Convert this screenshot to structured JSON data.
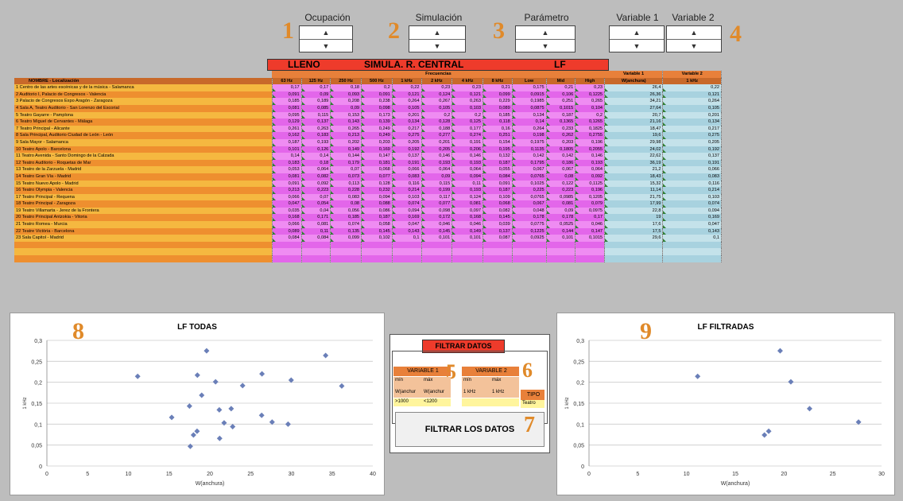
{
  "controls": [
    {
      "label": "Ocupación",
      "number": "1"
    },
    {
      "label": "Simulación",
      "number": "2"
    },
    {
      "label": "Parámetro",
      "number": "3"
    },
    {
      "label": "Variable 1",
      "number": ""
    },
    {
      "label": "Variable 2",
      "number": "4"
    }
  ],
  "spinner": {
    "up": "▲",
    "down": "▼"
  },
  "header": {
    "lleno": "LLENO",
    "simula": "SIMULA. R. CENTRAL",
    "lf": "LF",
    "frecuencias": "Frecuencias",
    "var1": "Variable 1",
    "var2": "Variable 2",
    "name_col": "NOMBRE - Localización",
    "freq_cols": [
      "63 Hz",
      "125 Hz",
      "250 Hz",
      "500 Hz",
      "1 kHz",
      "2 kHz",
      "4 kHz",
      "8 kHz",
      "Low",
      "Mid",
      "High"
    ],
    "var1_col": "W(anchura)",
    "var2_col": "1 kHz"
  },
  "rows": [
    {
      "name": "1  Centro de las artes escénicas y de la música - Salamanca",
      "f": [
        "0,17",
        "0,17",
        "0,18",
        "0,2",
        "0,22",
        "0,23",
        "0,23",
        "0,21",
        "0,175",
        "0,21",
        "0,23"
      ],
      "v1": "26,4",
      "v2": "0,22"
    },
    {
      "name": "2  Auditorio I, Palacio de Congresos - Valencia",
      "f": [
        "0,091",
        "0,09",
        "0,093",
        "0,091",
        "0,121",
        "0,124",
        "0,121",
        "0,099",
        "0,0915",
        "0,106",
        "0,1225"
      ],
      "v1": "26,36",
      "v2": "0,121"
    },
    {
      "name": "3  Palacio de Congresos Expo Aragón - Zaragoza",
      "f": [
        "0,185",
        "0,189",
        "0,208",
        "0,238",
        "0,264",
        "0,267",
        "0,263",
        "0,229",
        "0,1985",
        "0,251",
        "0,265"
      ],
      "v1": "34,21",
      "v2": "0,264"
    },
    {
      "name": "4  Sala A, Teatro Auditorio - San Lorenzo del Escorial",
      "f": [
        "0,081",
        "0,085",
        "0,09",
        "0,098",
        "0,105",
        "0,105",
        "0,103",
        "0,089",
        "0,0875",
        "0,1015",
        "0,104"
      ],
      "v1": "27,64",
      "v2": "0,105"
    },
    {
      "name": "5  Teatro Gayarre - Pamplona",
      "f": [
        "0,095",
        "0,115",
        "0,153",
        "0,173",
        "0,201",
        "0,2",
        "0,2",
        "0,185",
        "0,134",
        "0,187",
        "0,2"
      ],
      "v1": "20,7",
      "v2": "0,201"
    },
    {
      "name": "6  Teatro Miguel de Cervantes - Málaga",
      "f": [
        "0,129",
        "0,137",
        "0,143",
        "0,139",
        "0,134",
        "0,128",
        "0,125",
        "0,118",
        "0,14",
        "0,1365",
        "0,1265"
      ],
      "v1": "21,16",
      "v2": "0,134"
    },
    {
      "name": "7  Teatro Principal - Alicante",
      "f": [
        "0,261",
        "0,263",
        "0,265",
        "0,249",
        "0,217",
        "0,188",
        "0,177",
        "0,16",
        "0,264",
        "0,233",
        "0,1825"
      ],
      "v1": "18,47",
      "v2": "0,217"
    },
    {
      "name": "8  Sala Principal, Auditorio Ciudad de León - León",
      "f": [
        "0,162",
        "0,183",
        "0,213",
        "0,249",
        "0,275",
        "0,277",
        "0,274",
        "0,251",
        "0,198",
        "0,262",
        "0,2755"
      ],
      "v1": "19,6",
      "v2": "0,275"
    },
    {
      "name": "9  Sala Mayor - Salamanca",
      "f": [
        "0,187",
        "0,193",
        "0,202",
        "0,203",
        "0,205",
        "0,201",
        "0,191",
        "0,154",
        "0,1975",
        "0,203",
        "0,196"
      ],
      "v1": "29,98",
      "v2": "0,205"
    },
    {
      "name": "10  Teatro Apolo - Barcelona",
      "f": [
        "0,101",
        "0,126",
        "0,149",
        "0,169",
        "0,192",
        "0,205",
        "0,206",
        "0,195",
        "0,1135",
        "0,1805",
        "0,2055"
      ],
      "v1": "24,02",
      "v2": "0,192"
    },
    {
      "name": "11  Teatro Avenida - Santo Domingo de la Calzada",
      "f": [
        "0,14",
        "0,14",
        "0,144",
        "0,147",
        "0,137",
        "0,146",
        "0,146",
        "0,132",
        "0,142",
        "0,142",
        "0,146"
      ],
      "v1": "22,62",
      "v2": "0,137"
    },
    {
      "name": "12  Teatro Auditorio - Roquetas de Mar",
      "f": [
        "0,183",
        "0,18",
        "0,179",
        "0,181",
        "0,191",
        "0,193",
        "0,193",
        "0,187",
        "0,1795",
        "0,186",
        "0,193"
      ],
      "v1": "36,19",
      "v2": "0,191"
    },
    {
      "name": "13  Teatro de la Zarzuela - Madrid",
      "f": [
        "0,053",
        "0,064",
        "0,07",
        "0,068",
        "0,066",
        "0,064",
        "0,064",
        "0,055",
        "0,067",
        "0,067",
        "0,064"
      ],
      "v1": "21,2",
      "v2": "0,066"
    },
    {
      "name": "14  Teatro Gran Vía - Madrid",
      "f": [
        "0,081",
        "0,082",
        "0,073",
        "0,077",
        "0,083",
        "0,09",
        "0,094",
        "0,084",
        "0,0765",
        "0,08",
        "0,092"
      ],
      "v1": "18,43",
      "v2": "0,083"
    },
    {
      "name": "15  Teatro Nuevo Apolo - Madrid",
      "f": [
        "0,091",
        "0,092",
        "0,113",
        "0,128",
        "0,116",
        "0,115",
        "0,11",
        "0,091",
        "0,1025",
        "0,122",
        "0,1125"
      ],
      "v1": "15,32",
      "v2": "0,116"
    },
    {
      "name": "16  Teatro Olympia - Valencia",
      "f": [
        "0,213",
        "0,223",
        "0,228",
        "0,232",
        "0,214",
        "0,199",
        "0,193",
        "0,187",
        "0,225",
        "0,223",
        "0,196"
      ],
      "v1": "11,14",
      "v2": "0,214"
    },
    {
      "name": "17  Teatro Principal - Requena",
      "f": [
        "0,066",
        "0,07",
        "0,083",
        "0,094",
        "0,103",
        "0,117",
        "0,124",
        "0,109",
        "0,0765",
        "0,0985",
        "0,1205"
      ],
      "v1": "21,75",
      "v2": "0,103"
    },
    {
      "name": "18  Teatro Principal - Zaragoza",
      "f": [
        "0,047",
        "0,054",
        "0,08",
        "0,088",
        "0,074",
        "0,077",
        "0,081",
        "0,068",
        "0,067",
        "0,081",
        "0,079"
      ],
      "v1": "17,99",
      "v2": "0,074"
    },
    {
      "name": "19  Teatro Villamarta - Jerez de la Frontera",
      "f": [
        "0,035",
        "0,04",
        "0,056",
        "0,086",
        "0,094",
        "0,098",
        "0,097",
        "0,082",
        "0,048",
        "0,09",
        "0,0975"
      ],
      "v1": "22,8",
      "v2": "0,094"
    },
    {
      "name": "20  Teatro Principal Antzokia - Vitoria",
      "f": [
        "0,168",
        "0,171",
        "0,185",
        "0,187",
        "0,169",
        "0,172",
        "0,168",
        "0,145",
        "0,178",
        "0,178",
        "0,17"
      ],
      "v1": "19",
      "v2": "0,169"
    },
    {
      "name": "21  Teatro Romea - Murcia",
      "f": [
        "0,066",
        "0,081",
        "0,074",
        "0,058",
        "0,047",
        "0,046",
        "0,046",
        "0,039",
        "0,0775",
        "0,0525",
        "0,046"
      ],
      "v1": "17,6",
      "v2": "0,047"
    },
    {
      "name": "22  Teatre Victòria - Barcelona",
      "f": [
        "0,089",
        "0,11",
        "0,135",
        "0,145",
        "0,143",
        "0,145",
        "0,149",
        "0,137",
        "0,1225",
        "0,144",
        "0,147"
      ],
      "v1": "17,5",
      "v2": "0,143"
    },
    {
      "name": "23  Sala Capitol - Madrid",
      "f": [
        "0,084",
        "0,084",
        "0,099",
        "0,102",
        "0,1",
        "0,101",
        "0,101",
        "0,087",
        "0,0925",
        "0,101",
        "0,1015"
      ],
      "v1": "29,6",
      "v2": "0,1"
    }
  ],
  "filter": {
    "title": "FILTRAR DATOS",
    "var1": "VARIABLE 1",
    "var2": "VARIABLE 2",
    "min": "mín",
    "max": "máx",
    "w_min": "W(anchur",
    "w_max": "W(anchur",
    "k_min": "1 kHz",
    "k_max": "1 kHz",
    "val_min": ">1000",
    "val_max": "<1200",
    "tipo": "TIPO",
    "tipo_val": "Teatro",
    "num5": "5",
    "num6": "6",
    "num7": "7",
    "button": "FILTRAR LOS DATOS"
  },
  "chart_labels": {
    "left_num": "8",
    "right_num": "9"
  },
  "chart_data": [
    {
      "type": "scatter",
      "title": "LF TODAS",
      "xlabel": "W(anchura)",
      "ylabel": "1 kHz",
      "xlim": [
        0,
        40
      ],
      "ylim": [
        0,
        0.3
      ],
      "xticks": [
        "0",
        "5",
        "10",
        "15",
        "20",
        "25",
        "30",
        "35",
        "40"
      ],
      "yticks": [
        "0",
        "0,05",
        "0,1",
        "0,15",
        "0,2",
        "0,25",
        "0,3"
      ],
      "points": [
        [
          11.14,
          0.214
        ],
        [
          15.32,
          0.116
        ],
        [
          17.5,
          0.143
        ],
        [
          17.6,
          0.047
        ],
        [
          17.99,
          0.074
        ],
        [
          18.43,
          0.083
        ],
        [
          18.47,
          0.217
        ],
        [
          19,
          0.169
        ],
        [
          19.6,
          0.275
        ],
        [
          20.7,
          0.201
        ],
        [
          21.16,
          0.134
        ],
        [
          21.2,
          0.066
        ],
        [
          21.75,
          0.103
        ],
        [
          22.62,
          0.137
        ],
        [
          22.8,
          0.094
        ],
        [
          24.02,
          0.192
        ],
        [
          26.36,
          0.121
        ],
        [
          26.4,
          0.22
        ],
        [
          27.64,
          0.105
        ],
        [
          29.6,
          0.1
        ],
        [
          29.98,
          0.205
        ],
        [
          34.21,
          0.264
        ],
        [
          36.19,
          0.191
        ]
      ]
    },
    {
      "type": "scatter",
      "title": "LF FILTRADAS",
      "xlabel": "W(anchura)",
      "ylabel": "1 kHz",
      "xlim": [
        0,
        30
      ],
      "ylim": [
        0,
        0.3
      ],
      "xticks": [
        "0",
        "5",
        "10",
        "15",
        "20",
        "25",
        "30"
      ],
      "yticks": [
        "0",
        "0,05",
        "0,1",
        "0,15",
        "0,2",
        "0,25",
        "0,3"
      ],
      "points": [
        [
          11.14,
          0.214
        ],
        [
          17.99,
          0.074
        ],
        [
          18.43,
          0.083
        ],
        [
          19.6,
          0.275
        ],
        [
          20.7,
          0.201
        ],
        [
          22.62,
          0.137
        ],
        [
          27.64,
          0.105
        ]
      ]
    }
  ]
}
